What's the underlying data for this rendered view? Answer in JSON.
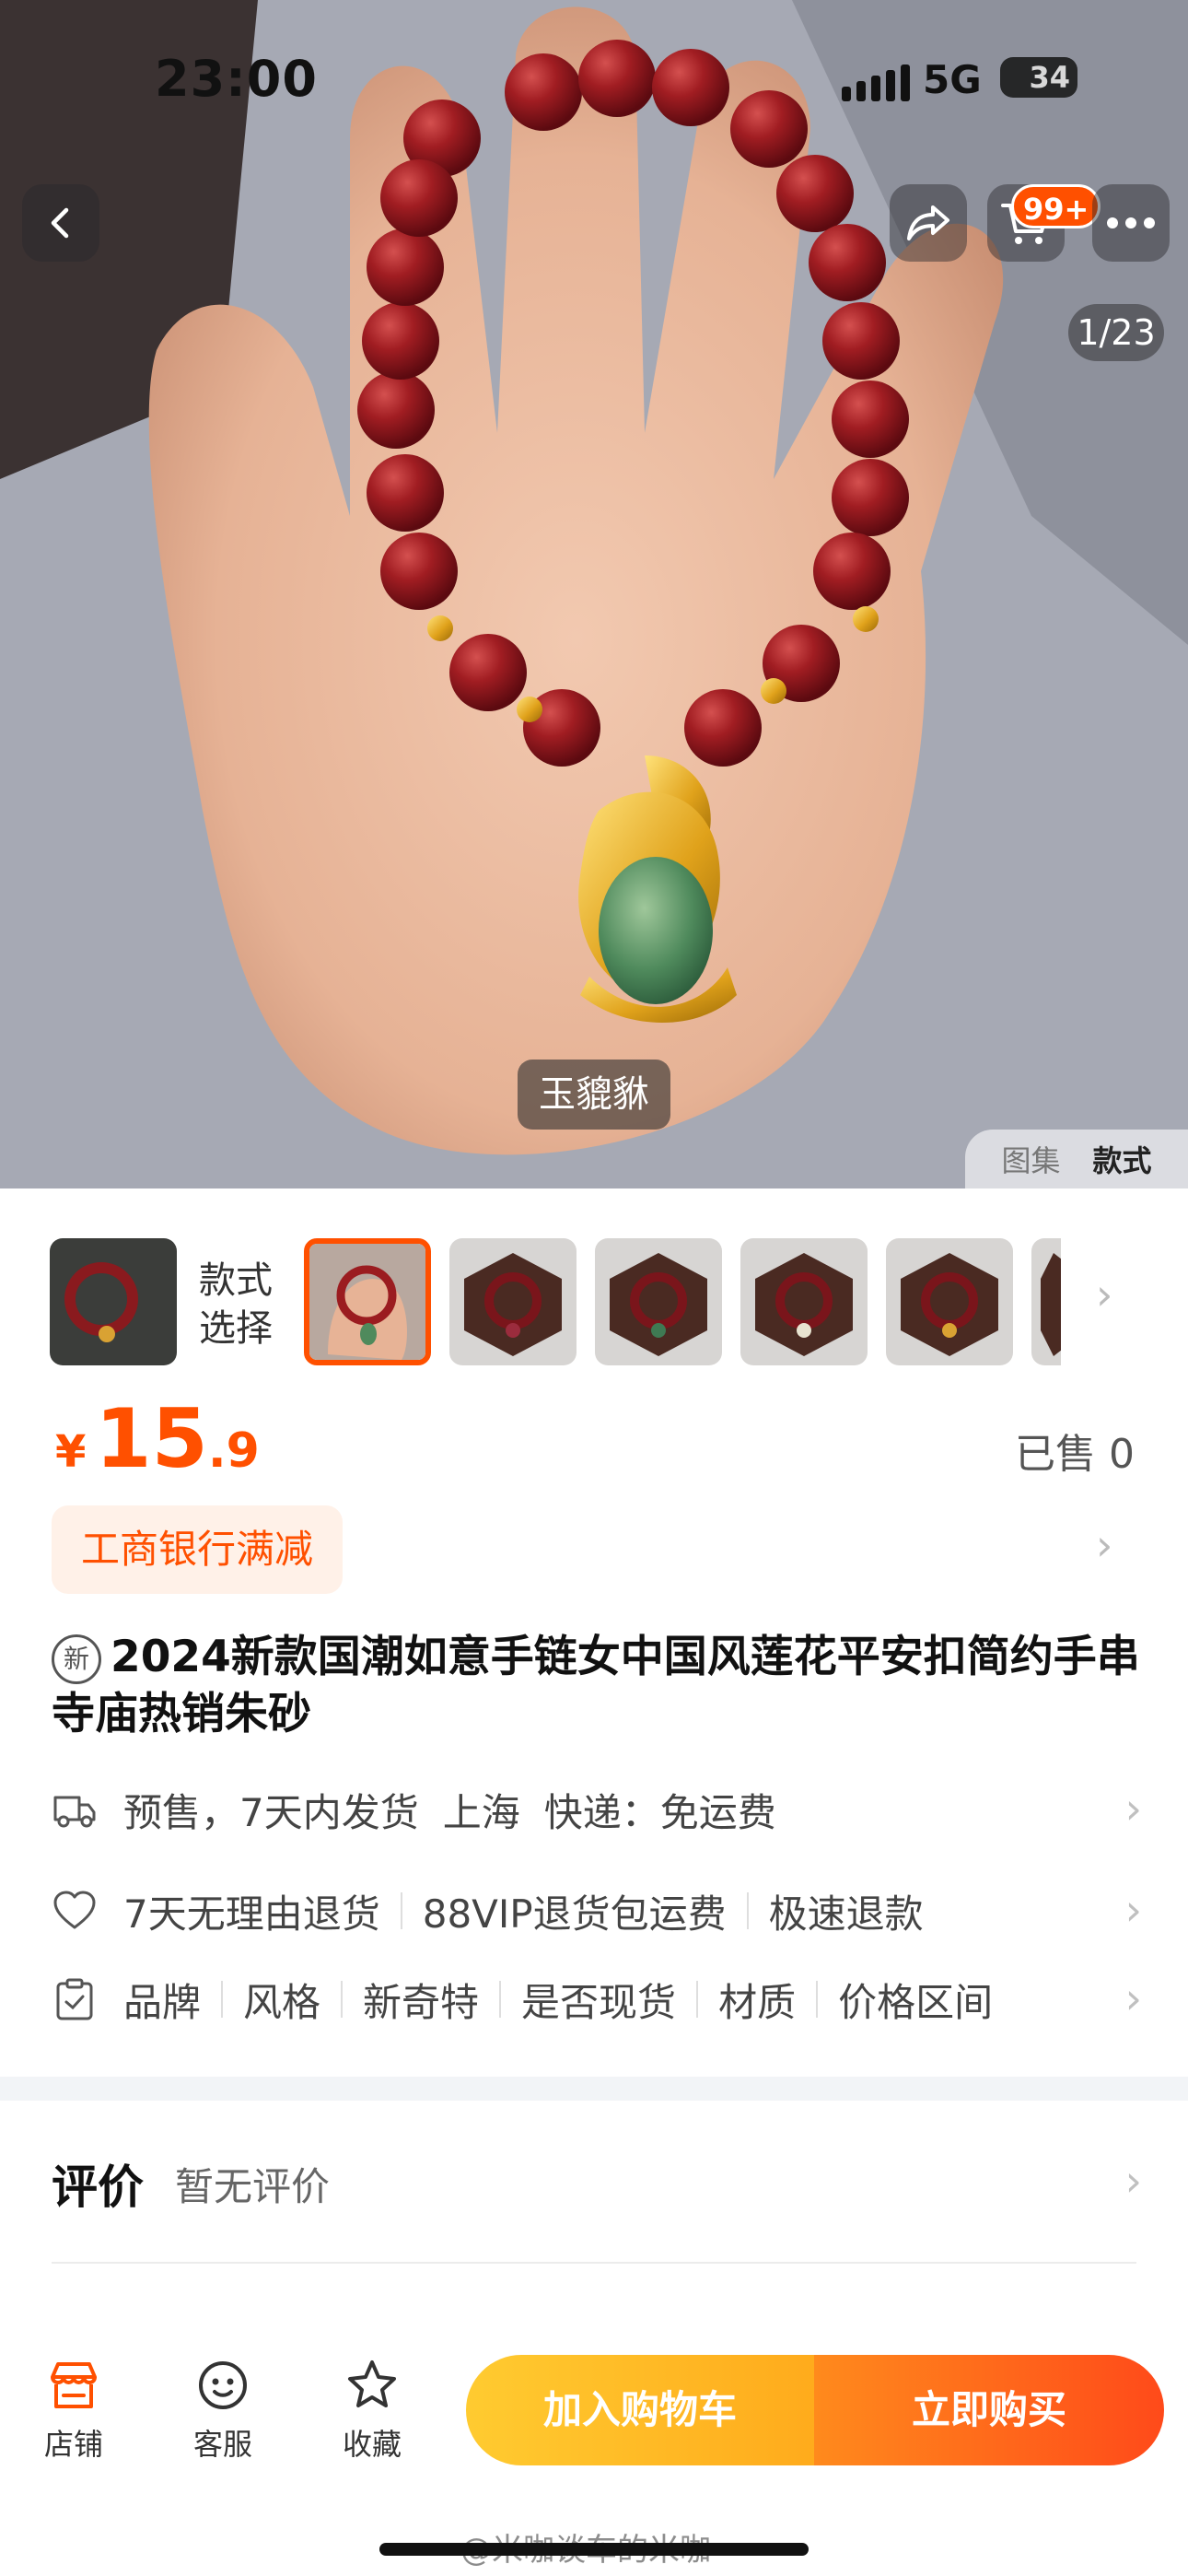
{
  "status_bar": {
    "time": "23:00",
    "network": "5G",
    "battery": "34"
  },
  "gallery": {
    "counter": "1/23",
    "pendant_label": "玉貔貅",
    "tabs": [
      "图集",
      "款式"
    ],
    "active_tab": "款式",
    "cart_badge": "99+",
    "icons": [
      "back-icon",
      "share-icon",
      "cart-icon",
      "more-icon"
    ]
  },
  "style_picker": {
    "label": "款式选择",
    "thumbnail_count": 7,
    "selected_index": 1
  },
  "price": {
    "currency": "¥",
    "integer": "15",
    "decimal": ".9",
    "sold": "已售 0"
  },
  "promotion": {
    "label": "工商银行满减"
  },
  "product": {
    "new_tag": "新",
    "title": "2024新款国潮如意手链女中国风莲花平安扣简约手串寺庙热销朱砂"
  },
  "shipping": {
    "presale": "预售，7天内发货",
    "origin": "上海",
    "express": "快递：免运费"
  },
  "guarantees": [
    "7天无理由退货",
    "88VIP退货包运费",
    "极速退款"
  ],
  "attributes": [
    "品牌",
    "风格",
    "新奇特",
    "是否现货",
    "材质",
    "价格区间"
  ],
  "reviews": {
    "title": "评价",
    "empty_text": "暂无评价"
  },
  "bottom_nav": {
    "shop": "店铺",
    "service": "客服",
    "favorite": "收藏"
  },
  "actions": {
    "add_to_cart": "加入购物车",
    "buy_now": "立即购买"
  },
  "colors": {
    "accent": "#ff5000",
    "promo_bg": "#fff1e8",
    "cart_button": "#ffb822",
    "buy_button": "#ff5a1a"
  },
  "watermark": "@米咖谈车的米咖"
}
